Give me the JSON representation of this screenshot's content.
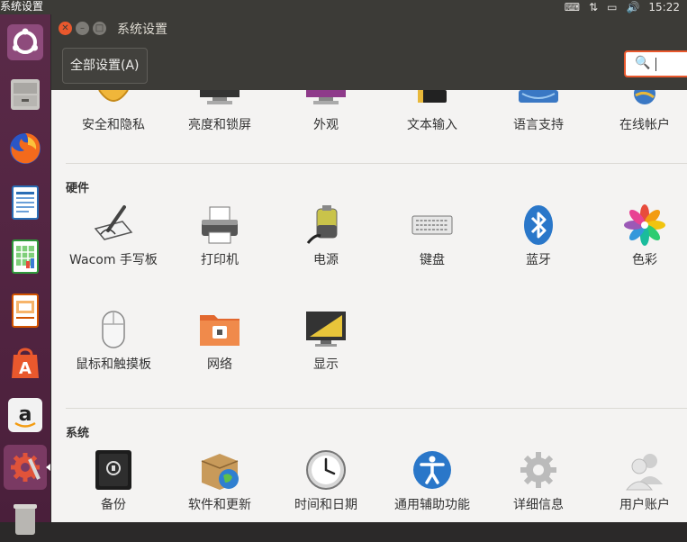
{
  "topbar": {
    "app_title": "系统设置",
    "clock": "15:22"
  },
  "launcher": {
    "items": [
      {
        "name": "ubuntu-dash-icon"
      },
      {
        "name": "file-manager-icon"
      },
      {
        "name": "firefox-icon"
      },
      {
        "name": "writer-icon"
      },
      {
        "name": "calc-icon"
      },
      {
        "name": "impress-icon"
      },
      {
        "name": "software-center-icon"
      },
      {
        "name": "amazon-icon"
      },
      {
        "name": "system-settings-icon"
      },
      {
        "name": "trash-icon"
      }
    ]
  },
  "window": {
    "title": "系统设置",
    "all_settings_label": "全部设置(A)"
  },
  "personal": {
    "items": [
      {
        "label": "安全和隐私",
        "icon": "privacy-icon"
      },
      {
        "label": "亮度和锁屏",
        "icon": "brightness-icon"
      },
      {
        "label": "外观",
        "icon": "appearance-icon"
      },
      {
        "label": "文本输入",
        "icon": "text-entry-icon"
      },
      {
        "label": "语言支持",
        "icon": "language-icon"
      },
      {
        "label": "在线帐户",
        "icon": "online-accounts-icon"
      }
    ]
  },
  "hardware": {
    "title": "硬件",
    "items": [
      {
        "label": "Wacom 手写板",
        "icon": "wacom-icon"
      },
      {
        "label": "打印机",
        "icon": "printer-icon"
      },
      {
        "label": "电源",
        "icon": "power-icon"
      },
      {
        "label": "键盘",
        "icon": "keyboard-icon"
      },
      {
        "label": "蓝牙",
        "icon": "bluetooth-icon"
      },
      {
        "label": "色彩",
        "icon": "color-icon"
      },
      {
        "label": "鼠标和触摸板",
        "icon": "mouse-icon"
      },
      {
        "label": "网络",
        "icon": "network-icon"
      },
      {
        "label": "显示",
        "icon": "display-icon"
      }
    ]
  },
  "system": {
    "title": "系统",
    "items": [
      {
        "label": "备份",
        "icon": "backup-icon"
      },
      {
        "label": "软件和更新",
        "icon": "software-updates-icon"
      },
      {
        "label": "时间和日期",
        "icon": "clock-icon"
      },
      {
        "label": "通用辅助功能",
        "icon": "accessibility-icon"
      },
      {
        "label": "详细信息",
        "icon": "details-icon"
      },
      {
        "label": "用户账户",
        "icon": "user-accounts-icon"
      }
    ]
  },
  "colors": {
    "accent": "#e9582d",
    "panel": "#3c3b37",
    "launcher": "#5a2a48",
    "background": "#f4f3f2"
  }
}
